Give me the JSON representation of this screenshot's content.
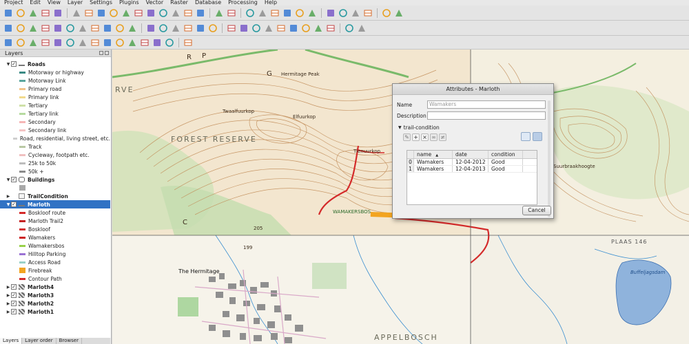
{
  "menubar": [
    "Project",
    "Edit",
    "View",
    "Layer",
    "Settings",
    "Plugins",
    "Vector",
    "Raster",
    "Database",
    "Processing",
    "Help"
  ],
  "toolbar_icons": {
    "row1": [
      "new-project-icon",
      "open-project-icon",
      "save-project-icon",
      "save-as-icon",
      "print-composer-icon",
      "sep",
      "pan-icon",
      "pan-to-selection-icon",
      "zoom-in-icon",
      "zoom-out-icon",
      "zoom-actual-icon",
      "zoom-full-icon",
      "zoom-layer-icon",
      "zoom-selection-icon",
      "zoom-last-icon",
      "zoom-next-icon",
      "refresh-icon",
      "sep",
      "identify-icon",
      "select-icon",
      "sep",
      "select-features-icon",
      "deselect-icon",
      "attribute-table-icon",
      "field-calculator-icon",
      "statistics-icon",
      "measure-icon",
      "sep",
      "map-tips-icon",
      "bookmark-icon",
      "new-bookmark-icon",
      "text-annotation-icon",
      "sep",
      "help-icon",
      "whats-this-icon"
    ],
    "row2": [
      "edit-pencil-icon",
      "current-edits-icon",
      "add-feature-icon",
      "move-feature-icon",
      "node-tool-icon",
      "delete-selected-icon",
      "cut-features-icon",
      "copy-features-icon",
      "paste-features-icon",
      "undo-icon",
      "redo-icon",
      "sep",
      "label-abc-icon",
      "pin-labels-icon",
      "show-hide-labels-icon",
      "move-label-icon",
      "rotate-label-icon",
      "change-label-icon",
      "sep",
      "georeferencer-icon",
      "topology-icon",
      "select-by-location-icon",
      "coordinate-capture-icon",
      "interpolation-icon",
      "grass-icon",
      "heatmap-icon",
      "vector-tool-icon",
      "grid-icon",
      "sep",
      "plugin-icon",
      "python-icon"
    ],
    "row3": [
      "digitize-capture-icon",
      "offset-curve-icon",
      "simplify-icon",
      "add-ring-icon",
      "add-part-icon",
      "fill-ring-icon",
      "delete-ring-icon",
      "delete-part-icon",
      "reshape-icon",
      "split-parts-icon",
      "split-features-icon",
      "merge-attributes-icon",
      "merge-features-icon",
      "rotate-point-icon",
      "sep",
      "advanced-digitize-icon"
    ]
  },
  "layers_panel": {
    "title": "Layers",
    "tabs": [
      "Layers",
      "Layer order",
      "Browser"
    ],
    "items": [
      {
        "label": "Roads",
        "level": 0,
        "bold": true,
        "expanded": true,
        "checked": true,
        "symbol": "line-group"
      },
      {
        "label": "Motorway or highway",
        "level": 1,
        "color": "#3a8a84"
      },
      {
        "label": "Motorway Link",
        "level": 1,
        "color": "#5ba69e"
      },
      {
        "label": "Primary road",
        "level": 1,
        "color": "#f4c48a"
      },
      {
        "label": "Primary link",
        "level": 1,
        "color": "#f2da8c"
      },
      {
        "label": "Tertiary",
        "level": 1,
        "color": "#cfe0a8"
      },
      {
        "label": "Tertiary link",
        "level": 1,
        "color": "#b6dba0"
      },
      {
        "label": "Secondary",
        "level": 1,
        "color": "#f6b6b6"
      },
      {
        "label": "Secondary link",
        "level": 1,
        "color": "#f4c4c4"
      },
      {
        "label": "Road, residential, living street, etc.",
        "level": 1,
        "color": "#cfcfcf"
      },
      {
        "label": "Track",
        "level": 1,
        "color": "#b9c8a4"
      },
      {
        "label": "Cycleway, footpath etc.",
        "level": 1,
        "color": "#f0c0c0"
      },
      {
        "label": "25k to 50k",
        "level": 1,
        "color": "#bcbcbc"
      },
      {
        "label": "50k +",
        "level": 1,
        "color": "#8a8a8a"
      },
      {
        "label": "Buildings",
        "level": 0,
        "bold": true,
        "expanded": true,
        "checked": true,
        "symbol": "polygon-group"
      },
      {
        "label": "",
        "level": 1,
        "color": "#a8a8a8",
        "fill": true
      },
      {
        "label": "TrailCondition",
        "level": 0,
        "bold": true,
        "expanded": false,
        "checked": null,
        "symbol": "table"
      },
      {
        "label": "Marloth",
        "level": 0,
        "bold": true,
        "expanded": true,
        "checked": true,
        "symbol": "line-group",
        "selected": true
      },
      {
        "label": "Boskloof route",
        "level": 1,
        "color": "#d42a2a"
      },
      {
        "label": "Marloth Trail2",
        "level": 1,
        "color": "#c42020"
      },
      {
        "label": "Boskloof",
        "level": 1,
        "color": "#d43030"
      },
      {
        "label": "Wamakers",
        "level": 1,
        "color": "#cc2222"
      },
      {
        "label": "Wamakersbos",
        "level": 1,
        "color": "#9ad14a"
      },
      {
        "label": "Hilltop Parking",
        "level": 1,
        "color": "#9a72d4"
      },
      {
        "label": "Access Road",
        "level": 1,
        "color": "#9ad1c8"
      },
      {
        "label": "Firebreak",
        "level": 1,
        "color": "#f2a420",
        "fill": true
      },
      {
        "label": "Contour Path",
        "level": 1,
        "color": "#d42a2a"
      },
      {
        "label": "Marloth4",
        "level": 0,
        "bold": true,
        "expanded": false,
        "checked": true,
        "symbol": "raster"
      },
      {
        "label": "Marloth3",
        "level": 0,
        "bold": true,
        "expanded": false,
        "checked": true,
        "symbol": "raster"
      },
      {
        "label": "Marloth2",
        "level": 0,
        "bold": true,
        "expanded": false,
        "checked": true,
        "symbol": "raster"
      },
      {
        "label": "Marloth1",
        "level": 0,
        "bold": true,
        "expanded": false,
        "checked": true,
        "symbol": "raster"
      }
    ]
  },
  "map_labels": {
    "forest_reserve": "FOREST RESERVE",
    "rve": "RVE",
    "hermitage_peak": "Hermitage Peak",
    "twaalfuurkop": "Twaalfuurkop",
    "elfuurkop": "Elfuurkop",
    "tienuurkop": "Tienuurkop",
    "plaas": "PLAAS 146",
    "appelbosch": "APPELBOSCH",
    "the_hermitage": "The Hermitage",
    "buffeljagsdam": "Buffeljagsdam",
    "wamakersbos": "WAMAKERSBOS",
    "g_letter": "G",
    "r_letter": "R",
    "c_letter": "C",
    "grid_199": "199",
    "grid_205": "205",
    "kop_label": "Suurbraakhoogte",
    "letter_p": "P"
  },
  "dialog": {
    "title": "Attributes - Marloth",
    "name_label": "Name",
    "name_value": "Wamakers",
    "description_label": "Description",
    "description_value": "",
    "group_label": "trail-condition",
    "columns": [
      "",
      "name",
      "date",
      "condition"
    ],
    "rows": [
      [
        "0",
        "Wamakers",
        "12-04-2012",
        "Good"
      ],
      [
        "1",
        "Wamakers",
        "12-04-2013",
        "Good"
      ]
    ],
    "cancel_label": "Cancel"
  }
}
